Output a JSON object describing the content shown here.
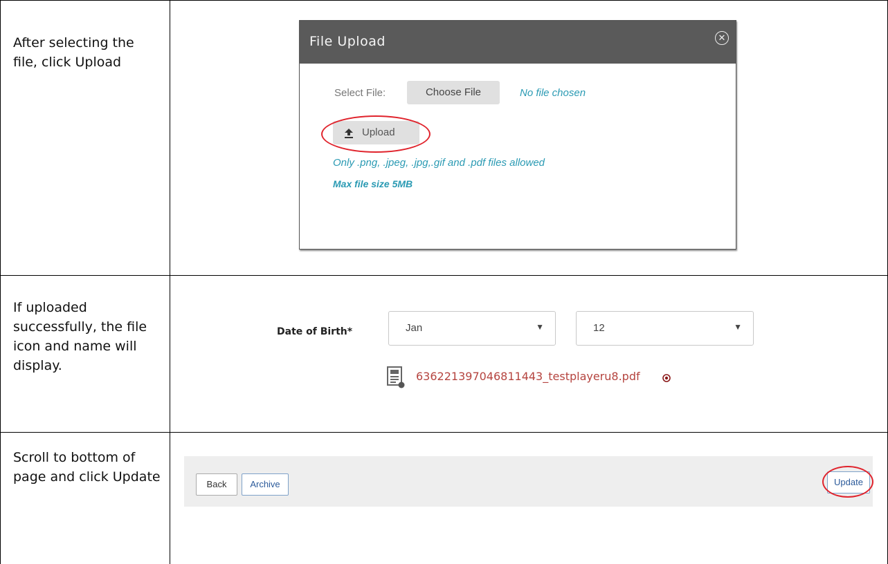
{
  "steps": [
    {
      "instruction": "After selecting the file, click Upload"
    },
    {
      "instruction": "If uploaded successfully, the file icon and name will display."
    },
    {
      "instruction": "Scroll to bottom of page and click Update"
    }
  ],
  "dialog": {
    "title": "File Upload",
    "select_label": "Select File:",
    "choose_button": "Choose File",
    "no_file": "No file chosen",
    "upload_button": "Upload",
    "allowed_types": "Only .png, .jpeg, .jpg,.gif and .pdf files allowed",
    "max_size": "Max file size 5MB"
  },
  "dob": {
    "label": "Date of Birth*",
    "month": "Jan",
    "day": "12"
  },
  "uploaded_file": {
    "name": "636221397046811443_testplayeru8.pdf"
  },
  "footer": {
    "back_button": "Back",
    "archive_button": "Archive",
    "update_button": "Update"
  },
  "colors": {
    "highlight_oval": "#e0232c",
    "info_text": "#2a9ab3",
    "file_name": "#b5443f"
  },
  "icons": [
    "close-circle-icon",
    "upload-arrow-icon",
    "pdf-file-icon",
    "remove-file-icon",
    "dropdown-caret-icon"
  ]
}
